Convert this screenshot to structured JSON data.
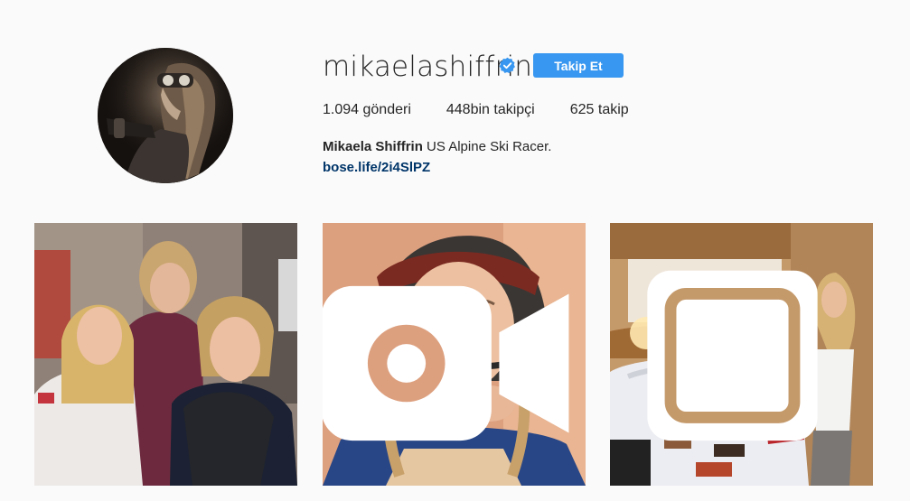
{
  "profile": {
    "username": "mikaelashiffrin",
    "verified_icon": "verified-badge-icon",
    "follow_label": "Takip Et",
    "stats": {
      "posts_value": "1.094",
      "posts_label": "gönderi",
      "followers_value": "448bin",
      "followers_label": "takipçi",
      "following_value": "625",
      "following_label": "takip"
    },
    "full_name": "Mikaela Shiffrin",
    "bio_text": "US Alpine Ski Racer.",
    "link": "bose.life/2i4SlPZ"
  },
  "posts": [
    {
      "type": "photo",
      "icon": null
    },
    {
      "type": "video",
      "icon": "video-camera-icon"
    },
    {
      "type": "carousel",
      "icon": "multiple-photos-icon"
    }
  ],
  "colors": {
    "background": "#fafafa",
    "button": "#3897f0",
    "link": "#003569",
    "verified": "#3897f0"
  }
}
